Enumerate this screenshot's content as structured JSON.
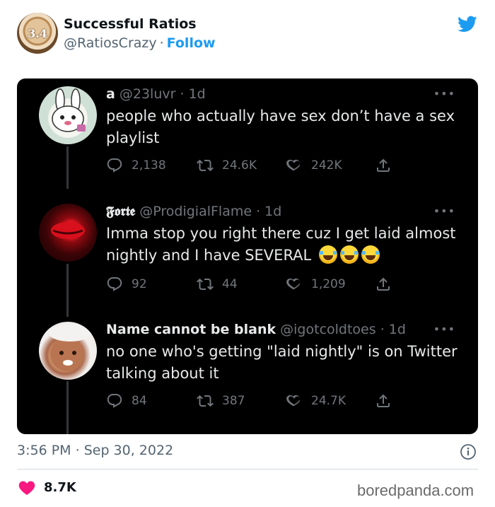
{
  "author": {
    "avatar_text": "3.4",
    "name": "Successful Ratios",
    "handle": "@RatiosCrazy",
    "separator": "·",
    "follow_label": "Follow"
  },
  "tweets": [
    {
      "name": "a",
      "handle": "@23luvr",
      "time": "· 1d",
      "more": "•••",
      "text": "people who actually have sex don’t have a sex playlist",
      "emojis": [],
      "replies": "2,138",
      "retweets": "24.6K",
      "likes": "242K"
    },
    {
      "name": "𝕱𝖔𝖗𝖙𝖊",
      "handle": "@ProdigialFlame",
      "time": "· 1d",
      "more": "•••",
      "text": "Imma stop you right there cuz I get laid almost nightly and I have SEVERAL",
      "emojis": [
        "face-with-tears-of-joy",
        "face-with-tears-of-joy",
        "face-with-tears-of-joy"
      ],
      "replies": "92",
      "retweets": "44",
      "likes": "1,209"
    },
    {
      "name": "Name cannot be blank",
      "handle": "@igotcoldtoes",
      "time": "· 1d",
      "more": "•••",
      "text": "no one who's getting \"laid nightly\" is on Twitter talking about it",
      "emojis": [],
      "replies": "84",
      "retweets": "387",
      "likes": "24.7K"
    }
  ],
  "post_meta": {
    "time": "3:56 PM",
    "separator": "·",
    "date": "Sep 30, 2022",
    "like_count": "8.7K"
  },
  "watermark": "boredpanda.com",
  "colors": {
    "accent": "#1d9bf0",
    "heart": "#f91880",
    "dark_bg": "#000000",
    "dark_text": "#e7e9ea",
    "muted": "#71767b"
  }
}
